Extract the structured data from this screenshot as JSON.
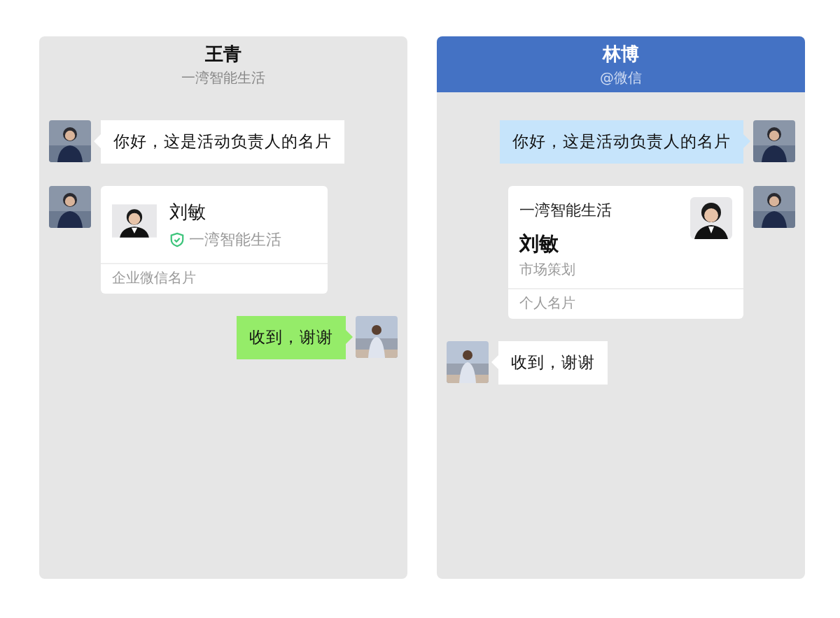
{
  "panels": [
    {
      "header": {
        "title": "王青",
        "subtitle": "一湾智能生活",
        "highlighted": false
      },
      "messages": [
        {
          "kind": "text",
          "outgoing": false,
          "color": "#ffffff",
          "text": "你好，这是活动负责人的名片"
        },
        {
          "kind": "work-card",
          "outgoing": false,
          "name": "刘敏",
          "company": "一湾智能生活",
          "verified": true,
          "footer": "企业微信名片"
        },
        {
          "kind": "text",
          "outgoing": true,
          "color": "#95ec69",
          "text": "收到，谢谢"
        }
      ]
    },
    {
      "header": {
        "title": "林博",
        "subtitle": "@微信",
        "highlighted": true
      },
      "messages": [
        {
          "kind": "text",
          "outgoing": true,
          "color": "#c6e4fb",
          "text": "你好，这是活动负责人的名片"
        },
        {
          "kind": "personal-card",
          "outgoing": true,
          "company": "一湾智能生活",
          "name": "刘敏",
          "role": "市场策划",
          "footer": "个人名片"
        },
        {
          "kind": "text",
          "outgoing": false,
          "color": "#ffffff",
          "text": "收到，谢谢"
        }
      ]
    }
  ]
}
